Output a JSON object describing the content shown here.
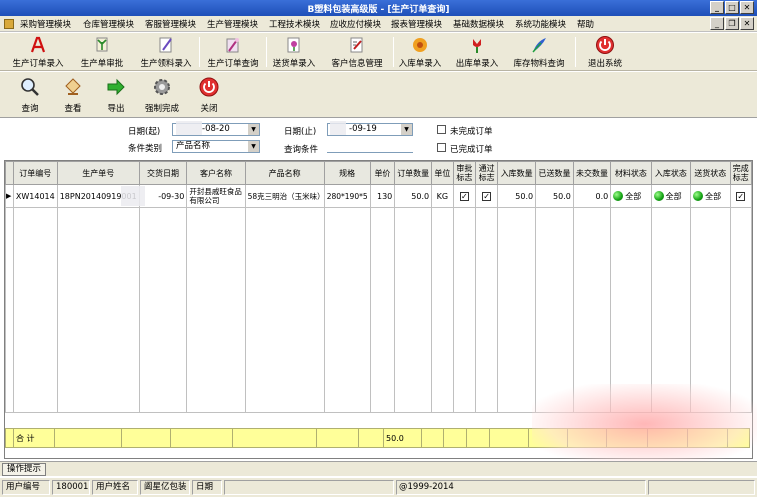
{
  "window": {
    "title": "B塑料包装高级版 - [生产订单查询]"
  },
  "menu": [
    "采购管理模块",
    "仓库管理模块",
    "客服管理模块",
    "生产管理模块",
    "工程技术模块",
    "应收应付模块",
    "报表管理模块",
    "基础数据模块",
    "系统功能模块",
    "帮助"
  ],
  "modules": [
    "生产订单录入",
    "生产单审批",
    "生产领料录入",
    "生产订单查询",
    "送货单录入",
    "客户信息管理",
    "入库单录入",
    "出库单录入",
    "库存物料查询",
    "退出系统"
  ],
  "toolbar": [
    "查询",
    "查看",
    "导出",
    "强制完成",
    "关闭"
  ],
  "filter": {
    "date_from_label": "日期(起)",
    "date_from_value": "-08-20",
    "date_to_label": "日期(止)",
    "date_to_value": "-09-19",
    "cond_type_label": "条件类别",
    "cond_type_value": "产品名称",
    "query_label": "查询条件",
    "query_value": "",
    "unfinished_label": "未完成订单",
    "finished_label": "已完成订单"
  },
  "grid": {
    "columns": [
      "订单编号",
      "生产单号",
      "交货日期",
      "客户名称",
      "产品名称",
      "规格",
      "单价",
      "订单数量",
      "单位",
      "审批标志",
      "通过标志",
      "入库数量",
      "已送数量",
      "未交数量",
      "材料状态",
      "入库状态",
      "送货状态",
      "完成标志"
    ],
    "rows": [
      {
        "order_no": "XW14014",
        "prod_no": "18PN20140919001",
        "delivery": "-09-30",
        "customer": "开封县戚旺食品有限公司",
        "product": "58克三明治（玉米味）",
        "spec": "280*190*5",
        "price": "130",
        "qty": "50.0",
        "unit": "KG",
        "approved": true,
        "passed": true,
        "in_qty": "50.0",
        "sent_qty": "50.0",
        "undelivered": "0.0",
        "mat_status": "全部",
        "in_status": "全部",
        "send_status": "全部",
        "done": true
      }
    ],
    "total_label": "合 计",
    "total_qty": "50.0"
  },
  "hint_tab": "操作提示",
  "status": {
    "user_no_label": "用户编号",
    "user_no": "180001",
    "user_name_label": "用户姓名",
    "user_name": "阖星亿包装",
    "date_label": "日期",
    "copyright": "@1999-2014"
  }
}
